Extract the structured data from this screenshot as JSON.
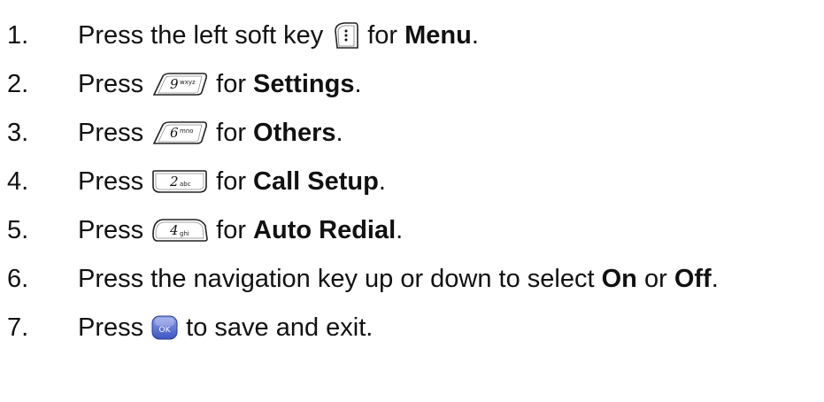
{
  "steps": [
    {
      "number": "1.",
      "before": "Press the left soft key",
      "key": "soft-key-icon",
      "after": "for",
      "bold": "Menu",
      "end": "."
    },
    {
      "number": "2.",
      "before": "Press",
      "key": "key-9-icon",
      "key_digit": "9",
      "key_letters": "wxyz",
      "after": "for",
      "bold": "Settings",
      "end": "."
    },
    {
      "number": "3.",
      "before": "Press",
      "key": "key-6-icon",
      "key_digit": "6",
      "key_letters": "mno",
      "after": "for",
      "bold": "Others",
      "end": "."
    },
    {
      "number": "4.",
      "before": "Press",
      "key": "key-2-icon",
      "key_digit": "2",
      "key_letters": "abc",
      "after": "for",
      "bold": "Call Setup",
      "end": "."
    },
    {
      "number": "5.",
      "before": "Press",
      "key": "key-4-icon",
      "key_digit": "4",
      "key_letters": "ghi",
      "after": "for",
      "bold": "Auto Redial",
      "end": "."
    },
    {
      "number": "6.",
      "before": "Press the navigation key up or down to select",
      "bold": "On",
      "middle": "or",
      "bold2": "Off",
      "end": "."
    },
    {
      "number": "7.",
      "before": "Press",
      "key": "ok-key-icon",
      "key_digit": "OK",
      "after": "to save and exit."
    }
  ]
}
